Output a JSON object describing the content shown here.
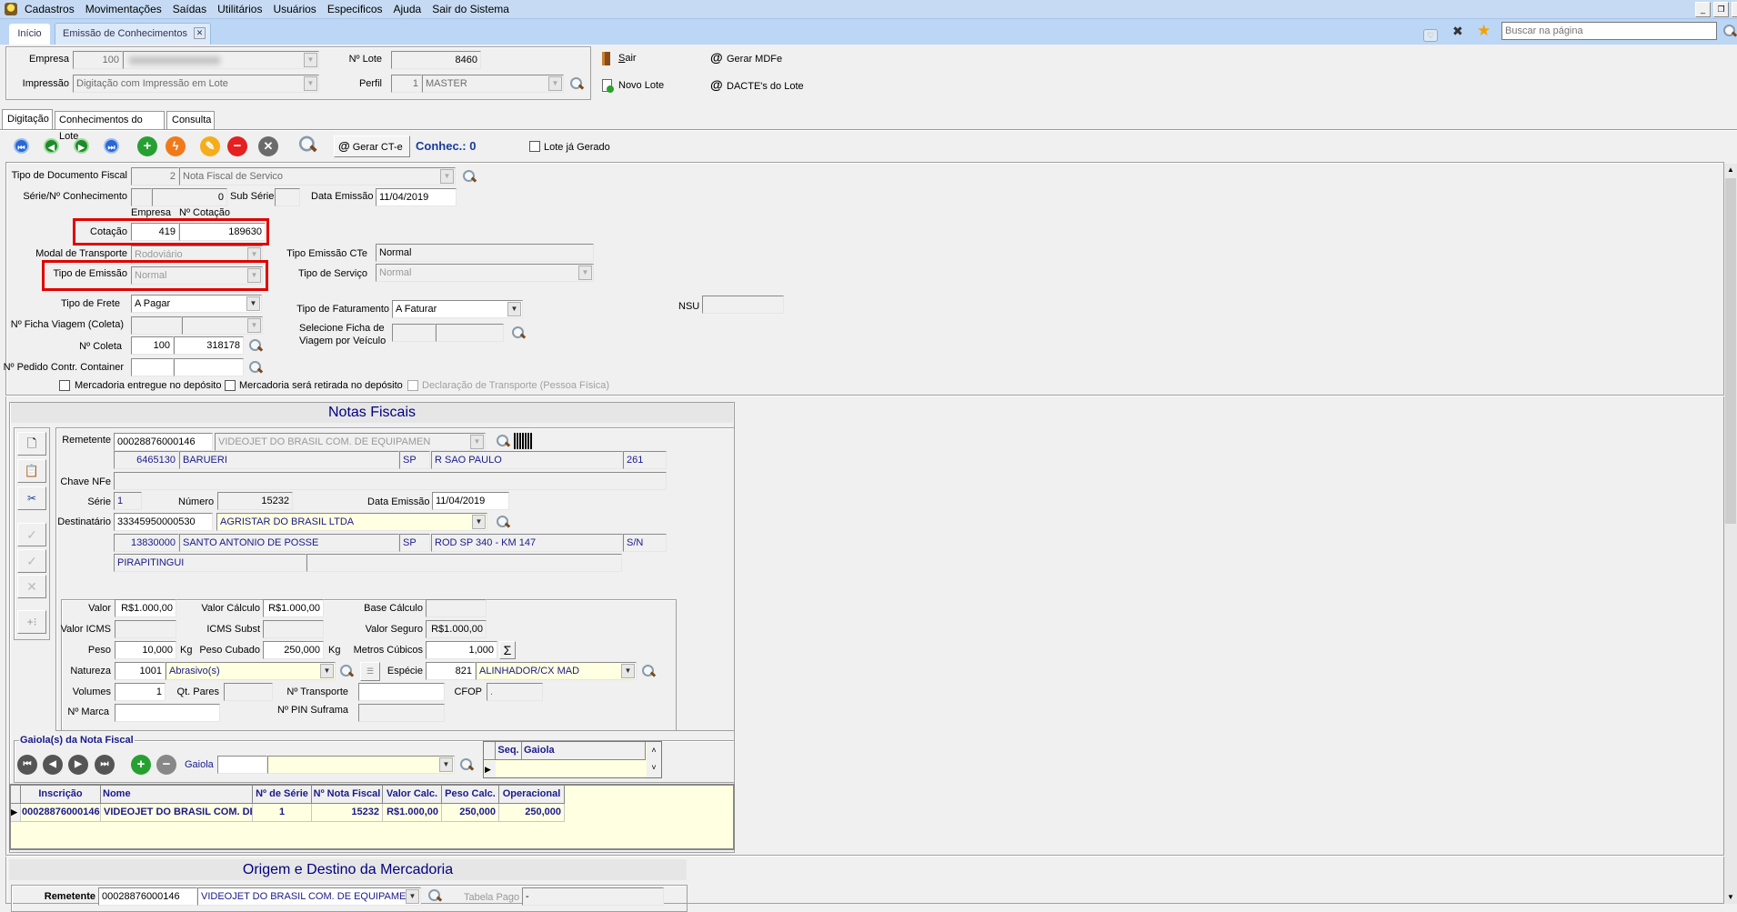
{
  "menu": {
    "items": [
      "Cadastros",
      "Movimentações",
      "Saídas",
      "Utilitários",
      "Usuários",
      "Especificos",
      "Ajuda",
      "Sair do Sistema"
    ]
  },
  "tabs": [
    {
      "label": "Início"
    },
    {
      "label": "Emissão de Conhecimentos",
      "active": true
    }
  ],
  "topbar": {
    "search_placeholder": "Buscar na página"
  },
  "header": {
    "empresa_label": "Empresa",
    "empresa_code": "100",
    "impressao_label": "Impressão",
    "impressao_value": "Digitação com Impressão em Lote",
    "lote_label": "Nº Lote",
    "lote_value": "8460",
    "perfil_label": "Perfil",
    "perfil_code": "1",
    "perfil_value": "MASTER",
    "sair": "Sair",
    "novo_lote": "Novo Lote",
    "gerar_mdfe": "Gerar MDFe",
    "dacte_lote": "DACTE's do Lote"
  },
  "subtabs": [
    "Digitação",
    "Conhecimentos do Lote",
    "Consulta"
  ],
  "toolbar": {
    "gerar_cte": "Gerar CT-e",
    "conhec": "Conhec.: 0",
    "lote_gerado": "Lote já Gerado"
  },
  "form": {
    "tipo_doc_label": "Tipo de Documento Fiscal",
    "tipo_doc_code": "2",
    "tipo_doc_value": "Nota Fiscal de Servico",
    "serie_label": "Série/Nº Conhecimento",
    "serie_num": "0",
    "sub_serie_label": "Sub Série",
    "data_emissao_label": "Data Emissão",
    "data_emissao": "11/04/2019",
    "col_empresa": "Empresa",
    "col_cotacao": "Nº Cotação",
    "cotacao_label": "Cotação",
    "cotacao_empresa": "419",
    "cotacao_num": "189630",
    "modal_label": "Modal de Transporte",
    "modal_value": "Rodoviário",
    "tipo_emissao_label": "Tipo de Emissão",
    "tipo_emissao_value": "Normal",
    "tipo_emissao_cte_label": "Tipo Emissão CTe",
    "tipo_emissao_cte_value": "Normal",
    "tipo_servico_label": "Tipo de Serviço",
    "tipo_servico_value": "Normal",
    "tipo_frete_label": "Tipo de Frete",
    "tipo_frete_value": "A Pagar",
    "tipo_fat_label": "Tipo de Faturamento",
    "tipo_fat_value": "A Faturar",
    "nsu_label": "NSU",
    "ficha_label": "Nº Ficha Viagem (Coleta)",
    "sel_ficha_label1": "Selecione Ficha de",
    "sel_ficha_label2": "Viagem por Veículo",
    "coleta_label": "Nº Coleta",
    "coleta_empresa": "100",
    "coleta_num": "318178",
    "pedido_label": "Nº Pedido Contr. Container",
    "chk_entregue": "Mercadoria entregue no depósito",
    "chk_retirada": "Mercadoria será retirada no depósito",
    "chk_declaracao": "Declaração de Transporte (Pessoa Física)"
  },
  "notas": {
    "title": "Notas Fiscais",
    "remetente_label": "Remetente",
    "remetente_cnpj": "00028876000146",
    "remetente_nome": "VIDEOJET DO BRASIL COM. DE EQUIPAMEN",
    "rem_cep": "6465130",
    "rem_cidade": "BARUERI",
    "rem_uf": "SP",
    "rem_rua": "R SAO PAULO",
    "rem_num": "261",
    "chave_label": "Chave NFe",
    "serie_label": "Série",
    "serie": "1",
    "numero_label": "Número",
    "numero": "15232",
    "data_label": "Data Emissão",
    "data": "11/04/2019",
    "dest_label": "Destinatário",
    "dest_cnpj": "33345950000530",
    "dest_nome": "AGRISTAR DO BRASIL LTDA",
    "dest_cep": "13830000",
    "dest_cidade": "SANTO ANTONIO DE POSSE",
    "dest_uf": "SP",
    "dest_rua": "ROD SP 340 - KM 147",
    "dest_num": "S/N",
    "dest_bairro": "PIRAPITINGUI",
    "valor_label": "Valor",
    "valor": "R$1.000,00",
    "valor_calc_label": "Valor Cálculo",
    "valor_calc": "R$1.000,00",
    "base_calc_label": "Base Cálculo",
    "valor_icms_label": "Valor ICMS",
    "icms_subst_label": "ICMS Subst",
    "valor_seguro_label": "Valor Seguro",
    "valor_seguro": "R$1.000,00",
    "peso_label": "Peso",
    "peso": "10,000",
    "kg": "Kg",
    "peso_cubado_label": "Peso Cubado",
    "peso_cubado": "250,000",
    "metros_label": "Metros Cúbicos",
    "metros": "1,000",
    "sigma": "Σ",
    "natureza_label": "Natureza",
    "natureza_code": "1001",
    "natureza": "Abrasivo(s)",
    "especie_label": "Espécie",
    "especie_code": "821",
    "especie": "ALINHADOR/CX MAD",
    "volumes_label": "Volumes",
    "volumes": "1",
    "qt_pares_label": "Qt. Pares",
    "transporte_label": "Nº Transporte",
    "cfop_label": "CFOP",
    "cfop": ".",
    "marca_label": "Nº Marca",
    "pin_label": "Nº PIN Suframa"
  },
  "gaiola": {
    "legend": "Gaiola(s) da Nota Fiscal",
    "label": "Gaiola",
    "grid_headers": [
      "Seq.",
      "Gaiola"
    ]
  },
  "grid": {
    "headers": [
      "Inscrição",
      "Nome",
      "Nº de Série",
      "Nº Nota Fiscal",
      "Valor Calc.",
      "Peso Calc.",
      "Operacional"
    ],
    "rows": [
      [
        "00028876000146",
        "VIDEOJET DO BRASIL COM. DE",
        "1",
        "15232",
        "R$1.000,00",
        "250,000",
        "250,000"
      ]
    ]
  },
  "origem": {
    "title": "Origem e Destino da Mercadoria",
    "remetente_label": "Remetente",
    "remetente_cnpj": "00028876000146",
    "remetente_nome": "VIDEOJET DO BRASIL COM. DE EQUIPAMEN",
    "tabela_label": "Tabela Pago",
    "tabela_value": "-"
  },
  "colors": {
    "menu_bg": "#c6dbf3",
    "highlight": "#e00000",
    "title": "#000080",
    "grid_bg": "#ffffe1"
  }
}
